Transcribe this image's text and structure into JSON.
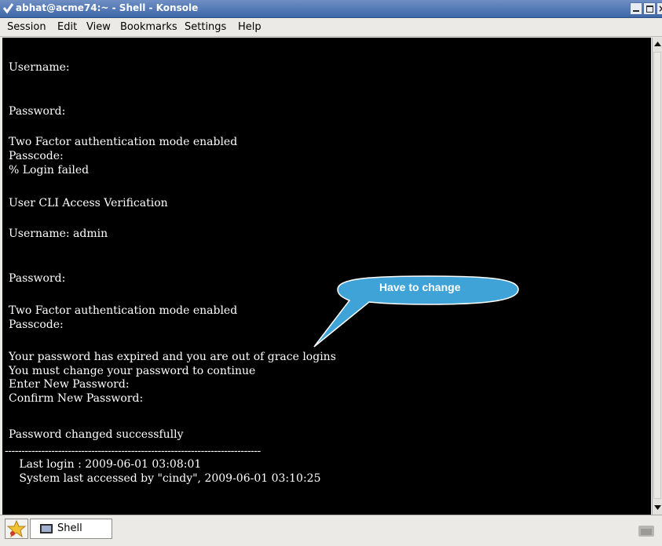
{
  "window": {
    "title": "abhat@acme74:~ - Shell - Konsole",
    "close_glyph": "×"
  },
  "menu": {
    "items": [
      "Session",
      "Edit",
      "View",
      "Bookmarks",
      "Settings",
      "Help"
    ]
  },
  "terminal": {
    "lines": [
      "Username:",
      "Password:",
      "Two Factor authentication mode enabled",
      "Passcode:",
      "% Login failed",
      "User CLI Access Verification",
      "Username: admin",
      "Password:",
      "Two Factor authentication mode enabled",
      "Passcode:",
      "Your password has expired and you are out of grace logins",
      "You must change your password to continue",
      "Enter New Password:",
      "Confirm New Password:",
      "Password changed successfully",
      "-----------------------------------------------------------------------------",
      "   Last login : 2009-06-01 03:08:01",
      "   System last accessed by \"cindy\", 2009-06-01 03:10:25"
    ]
  },
  "callout": {
    "text": "Have to change",
    "color": "#3fa3d8"
  },
  "tabs": {
    "items": [
      {
        "label": "Shell",
        "icon": "terminal-icon"
      }
    ]
  },
  "icons": {
    "title": "checkmark-icon",
    "new_session": "konsole-star-icon",
    "close_session": "close-session-icon"
  },
  "colors": {
    "titlebar": "#4d74b3",
    "terminal_bg": "#000000",
    "terminal_fg": "#ffffff",
    "callout": "#3fa3d8"
  }
}
